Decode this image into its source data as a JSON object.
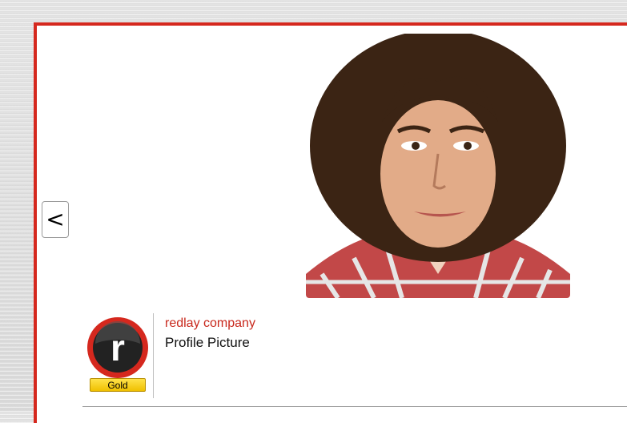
{
  "navigation": {
    "prev_label": "<"
  },
  "photo": {
    "description_icon": "profile-photo"
  },
  "post": {
    "company_name": "redlay company",
    "caption": "Profile Picture",
    "badge_label": "Gold",
    "avatar_letter": "r"
  },
  "colors": {
    "accent": "#d5281e",
    "link": "#c8281c",
    "badge": "#f5cc00"
  }
}
